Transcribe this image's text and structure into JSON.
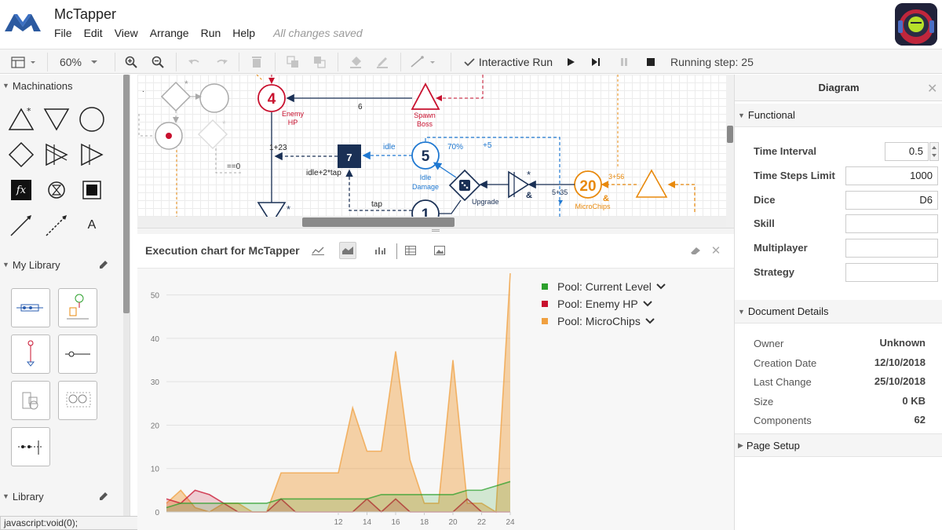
{
  "app": {
    "title": "McTapper",
    "menu": [
      "File",
      "Edit",
      "View",
      "Arrange",
      "Run",
      "Help"
    ],
    "save_status": "All changes saved"
  },
  "toolbar": {
    "zoom": "60%",
    "run_mode": "Interactive Run",
    "running_step": "Running step: 25"
  },
  "left_sidebar": {
    "sections": {
      "machinations": "Machinations",
      "my_library": "My Library",
      "library": "Library"
    },
    "text_tool_label": "A",
    "fx_label": "fx",
    "status_tip": "javascript:void(0);"
  },
  "diagram": {
    "nodes": {
      "enemy_value": "4",
      "enemy_label": "Enemy",
      "enemy_label2": "HP",
      "spawn_label": "Spawn",
      "spawn_label2": "Boss",
      "converter_value": "7",
      "idle_value": "5",
      "idle_label": "Idle",
      "idle_label2": "Damage",
      "tap_value": "1",
      "microchips_value": "20",
      "microchips_amp": "&",
      "microchips_label": "MicroChips",
      "upgrade_label": "Upgrade",
      "amp_symbol": "&"
    },
    "edge_labels": {
      "six": "6",
      "plus23": "1+23",
      "idle": "idle",
      "pct70": "70%",
      "plus5": "+5",
      "idle_tap": "idle+2*tap",
      "tap": "tap",
      "eq0": "==0",
      "r535": "5+35",
      "r356": "3+56"
    }
  },
  "chart_panel": {
    "title": "Execution chart for McTapper"
  },
  "chart_data": {
    "type": "area",
    "x": [
      0,
      1,
      2,
      3,
      4,
      5,
      6,
      7,
      8,
      9,
      10,
      11,
      12,
      13,
      14,
      15,
      16,
      17,
      18,
      19,
      20,
      21,
      22,
      23,
      24
    ],
    "xticks": [
      "12",
      "14",
      "16",
      "18",
      "20",
      "22",
      "24"
    ],
    "yticks": [
      "0",
      "10",
      "20",
      "30",
      "40",
      "50"
    ],
    "ylim": [
      0,
      55
    ],
    "series": [
      {
        "name": "Pool: Current Level",
        "color": "#2ca02c",
        "values": [
          1,
          2,
          2,
          2,
          2,
          2,
          2,
          2,
          3,
          3,
          3,
          3,
          3,
          3,
          3,
          4,
          4,
          4,
          4,
          4,
          4,
          5,
          5,
          6,
          7
        ]
      },
      {
        "name": "Pool: Enemy HP",
        "color": "#c8102e",
        "values": [
          3,
          2,
          5,
          4,
          2,
          0,
          0,
          0,
          3,
          0,
          0,
          0,
          0,
          0,
          3,
          0,
          3,
          0,
          0,
          0,
          0,
          3,
          0,
          0,
          0
        ]
      },
      {
        "name": "Pool: MicroChips",
        "color": "#f0a040",
        "values": [
          2,
          5,
          1,
          0,
          2,
          2,
          0,
          0,
          9,
          9,
          9,
          9,
          9,
          24,
          14,
          14,
          37,
          12,
          2,
          2,
          35,
          2,
          2,
          0,
          55
        ]
      }
    ],
    "legend_position": "top-right",
    "grid": true
  },
  "right_panel": {
    "title": "Diagram",
    "functional_label": "Functional",
    "fields": [
      {
        "label": "Time Interval",
        "value": "0.5"
      },
      {
        "label": "Time Steps Limit",
        "value": "1000"
      },
      {
        "label": "Dice",
        "value": "D6"
      },
      {
        "label": "Skill",
        "value": ""
      },
      {
        "label": "Multiplayer",
        "value": ""
      },
      {
        "label": "Strategy",
        "value": ""
      }
    ],
    "document_details_label": "Document Details",
    "details": [
      {
        "label": "Owner",
        "value": "Unknown"
      },
      {
        "label": "Creation Date",
        "value": "12/10/2018"
      },
      {
        "label": "Last Change",
        "value": "25/10/2018"
      },
      {
        "label": "Size",
        "value": "0 KB"
      },
      {
        "label": "Components",
        "value": "62"
      }
    ],
    "page_setup_label": "Page Setup"
  },
  "colors": {
    "brand_blue": "#2c5aa0",
    "enemy_red": "#c8102e",
    "idle_blue": "#1f78d1",
    "microchips_orange": "#e8890c",
    "dark_node": "#1a3055"
  }
}
